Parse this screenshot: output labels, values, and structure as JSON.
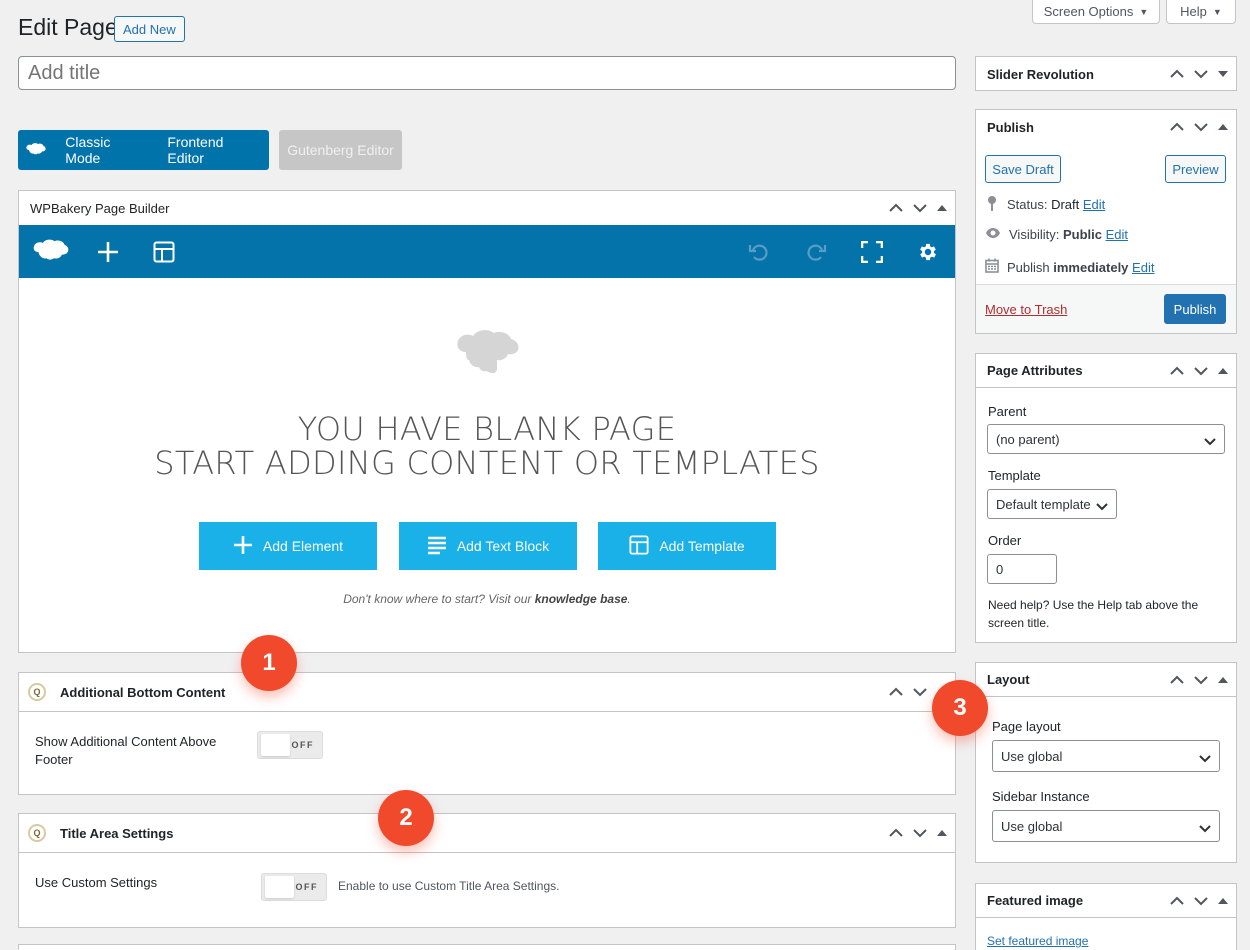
{
  "top_tabs": {
    "screen_options": "Screen Options",
    "help": "Help"
  },
  "header": {
    "title": "Edit Page",
    "add_new": "Add New"
  },
  "title_field": {
    "placeholder": "Add title",
    "value": ""
  },
  "editor_modes": {
    "classic": "Classic Mode",
    "frontend": "Frontend Editor",
    "gutenberg": "Gutenberg Editor"
  },
  "wpbakery": {
    "title": "WPBakery Page Builder",
    "blank_line1": "YOU HAVE BLANK PAGE",
    "blank_line2": "START ADDING CONTENT OR TEMPLATES",
    "btn_add_element": "Add Element",
    "btn_add_text_block": "Add Text Block",
    "btn_add_template": "Add Template",
    "hint_prefix": "Don't know where to start? Visit our ",
    "hint_link": "knowledge base",
    "hint_suffix": "."
  },
  "additional_bottom": {
    "title": "Additional Bottom Content",
    "field_label": "Show Additional Content Above Footer",
    "toggle": "OFF"
  },
  "title_area": {
    "title": "Title Area Settings",
    "field_label": "Use Custom Settings",
    "toggle": "OFF",
    "description": "Enable to use Custom Title Area Settings."
  },
  "badges": [
    "1",
    "2",
    "3"
  ],
  "sidebar": {
    "slider_revolution": {
      "title": "Slider Revolution"
    },
    "publish": {
      "title": "Publish",
      "save_draft": "Save Draft",
      "preview": "Preview",
      "status_label": "Status:",
      "status_value": "Draft",
      "visibility_label": "Visibility:",
      "visibility_value": "Public",
      "publish_label": "Publish",
      "publish_value": "immediately",
      "edit": "Edit",
      "move_to_trash": "Move to Trash",
      "publish_button": "Publish"
    },
    "page_attributes": {
      "title": "Page Attributes",
      "parent_label": "Parent",
      "parent_value": "(no parent)",
      "template_label": "Template",
      "template_value": "Default template",
      "order_label": "Order",
      "order_value": "0",
      "help_text": "Need help? Use the Help tab above the screen title."
    },
    "layout": {
      "title": "Layout",
      "page_layout_label": "Page layout",
      "page_layout_value": "Use global",
      "sidebar_instance_label": "Sidebar Instance",
      "sidebar_instance_value": "Use global"
    },
    "featured_image": {
      "title": "Featured image",
      "link": "Set featured image"
    }
  },
  "colors": {
    "wp_blue": "#2271b1",
    "vc_blue": "#0473aa",
    "vc_button": "#1ab0e8",
    "badge": "#f0492c"
  }
}
